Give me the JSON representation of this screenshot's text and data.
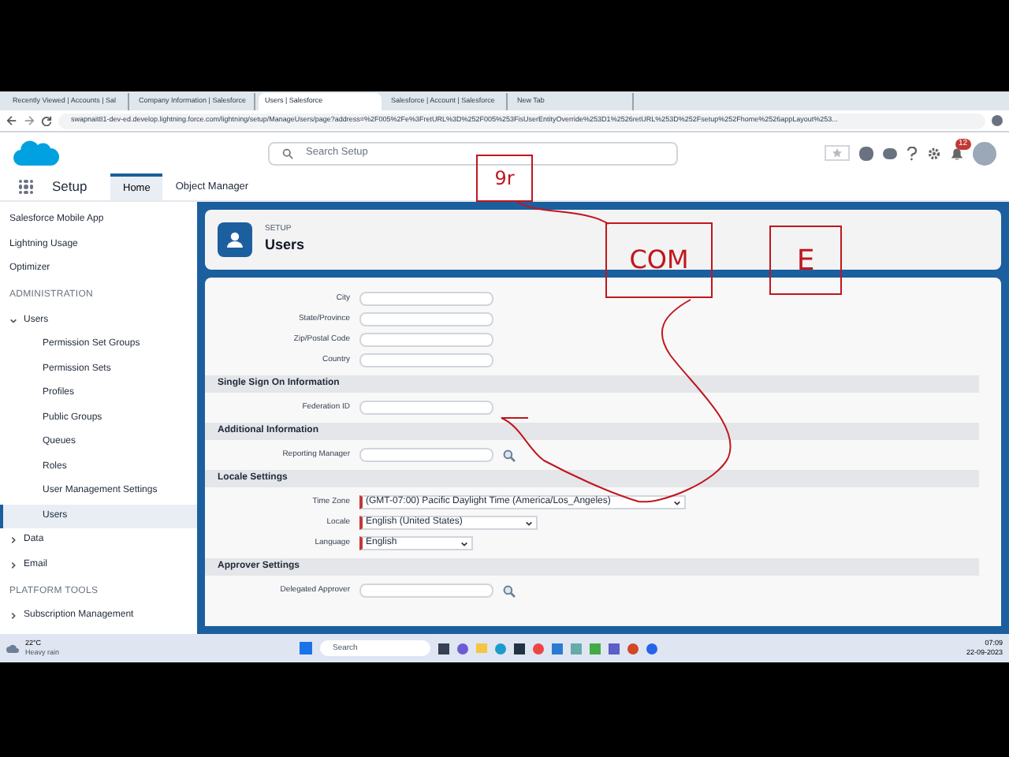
{
  "browser": {
    "tabs": [
      {
        "label": "Recently Viewed | Accounts | Sal",
        "selected": false
      },
      {
        "label": "Company Information | Salesforce",
        "selected": false
      },
      {
        "label": "Users | Salesforce",
        "selected": true
      },
      {
        "label": "Salesforce | Account | Salesforce",
        "selected": false
      },
      {
        "label": "New Tab",
        "selected": false
      }
    ],
    "url": "swapnait81-dev-ed.develop.lightning.force.com/lightning/setup/ManageUsers/page?address=%2F005%2Fe%3FretURL%3D%252F005%253FisUserEntityOverride%253D1%2526retURL%253D%252Fsetup%252Fhome%2526appLayout%253..."
  },
  "header": {
    "search_placeholder": "Search Setup",
    "notification_count": "12"
  },
  "nav": {
    "app": "Setup",
    "tabs": [
      {
        "label": "Home",
        "selected": true
      },
      {
        "label": "Object Manager",
        "selected": false
      }
    ]
  },
  "sidebar": {
    "items": [
      {
        "kind": "link",
        "label": "Salesforce Mobile App",
        "selected": false
      },
      {
        "kind": "link",
        "label": "Lightning Usage",
        "selected": false
      },
      {
        "kind": "link",
        "label": "Optimizer",
        "selected": false
      },
      {
        "kind": "heading",
        "label": "ADMINISTRATION"
      },
      {
        "kind": "group",
        "label": "Users",
        "expanded": true,
        "children": [
          {
            "label": "Permission Set Groups",
            "selected": false
          },
          {
            "label": "Permission Sets",
            "selected": false
          },
          {
            "label": "Profiles",
            "selected": false
          },
          {
            "label": "Public Groups",
            "selected": false
          },
          {
            "label": "Queues",
            "selected": false
          },
          {
            "label": "Roles",
            "selected": false
          },
          {
            "label": "User Management Settings",
            "selected": false
          },
          {
            "label": "Users",
            "selected": true
          }
        ]
      },
      {
        "kind": "group",
        "label": "Data",
        "expanded": false
      },
      {
        "kind": "group",
        "label": "Email",
        "expanded": false
      },
      {
        "kind": "heading",
        "label": "PLATFORM TOOLS"
      },
      {
        "kind": "group",
        "label": "Subscription Management",
        "expanded": false
      }
    ]
  },
  "page_header": {
    "eyebrow": "SETUP",
    "title": "Users"
  },
  "form": [
    {
      "kind": "input",
      "label": "City"
    },
    {
      "kind": "input",
      "label": "State/Province"
    },
    {
      "kind": "input",
      "label": "Zip/Postal Code"
    },
    {
      "kind": "input",
      "label": "Country"
    },
    {
      "kind": "section",
      "label": "Single Sign On Information"
    },
    {
      "kind": "input",
      "label": "Federation ID"
    },
    {
      "kind": "section",
      "label": "Additional Information"
    },
    {
      "kind": "lookup",
      "label": "Reporting Manager"
    },
    {
      "kind": "section",
      "label": "Locale Settings"
    },
    {
      "kind": "select",
      "label": "Time Zone",
      "value": "(GMT-07:00) Pacific Daylight Time (America/Los_Angeles)"
    },
    {
      "kind": "select",
      "label": "Locale",
      "value": "English (United States)"
    },
    {
      "kind": "select",
      "label": "Language",
      "value": "English"
    },
    {
      "kind": "section",
      "label": "Approver Settings"
    },
    {
      "kind": "lookup",
      "label": "Delegated Approver"
    }
  ],
  "annotations": [
    "9r",
    "COM",
    "E"
  ],
  "taskbar": {
    "temperature": "22°C",
    "weather": "Heavy rain",
    "search": "Search",
    "time": "07:09",
    "date": "22-09-2023"
  }
}
